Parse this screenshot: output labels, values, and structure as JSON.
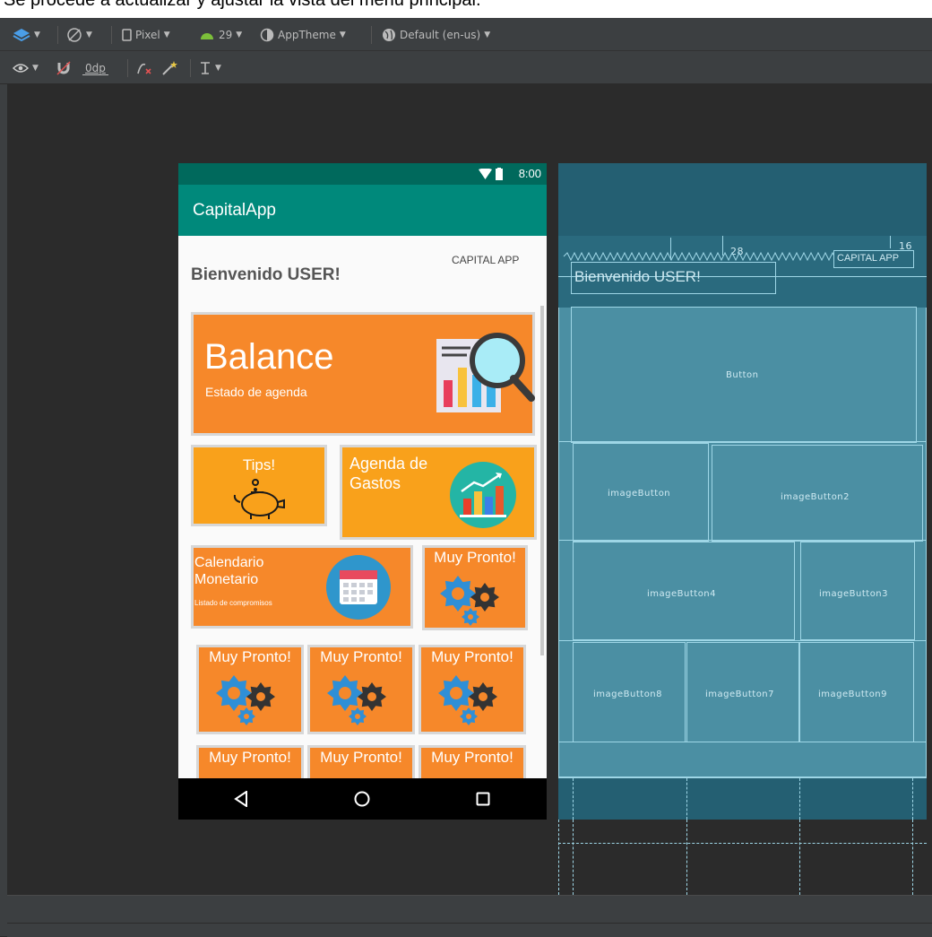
{
  "caption": {
    "text": "Se procede a actualizar y ajustar la vista del menú principal."
  },
  "toolbar1": {
    "device": "Pixel",
    "api": "29",
    "theme": "AppTheme",
    "locale": "Default (en-us)"
  },
  "toolbar2": {
    "margin": "0dp"
  },
  "phone": {
    "status_time": "8:00",
    "app_title": "CapitalApp",
    "welcome": "Bienvenido USER!",
    "brand": "CAPITAL APP",
    "balance": {
      "title": "Balance",
      "subtitle": "Estado de agenda"
    },
    "tips": {
      "title": "Tips!"
    },
    "agenda": {
      "title": "Agenda de Gastos"
    },
    "calendario": {
      "title": "Calendario Monetario",
      "subtitle": "Listado de compromisos"
    },
    "pronto": "Muy Pronto!"
  },
  "blueprint": {
    "welcome": "Bienvenido USER!",
    "brand": "CAPITAL APP",
    "dim1": "28",
    "dim2": "16",
    "button": "Button",
    "imageButton": "imageButton",
    "imageButton2": "imageButton2",
    "imageButton4": "imageButton4",
    "imageButton3": "imageButton3",
    "imageButton8": "imageButton8",
    "imageButton7": "imageButton7",
    "imageButton9": "imageButton9"
  },
  "colors": {
    "statusbar": "#00695c",
    "appbar": "#00897b",
    "card_orange": "#f6882a",
    "card_yellow": "#f9a11b",
    "blueprint": "#2d6f85"
  }
}
